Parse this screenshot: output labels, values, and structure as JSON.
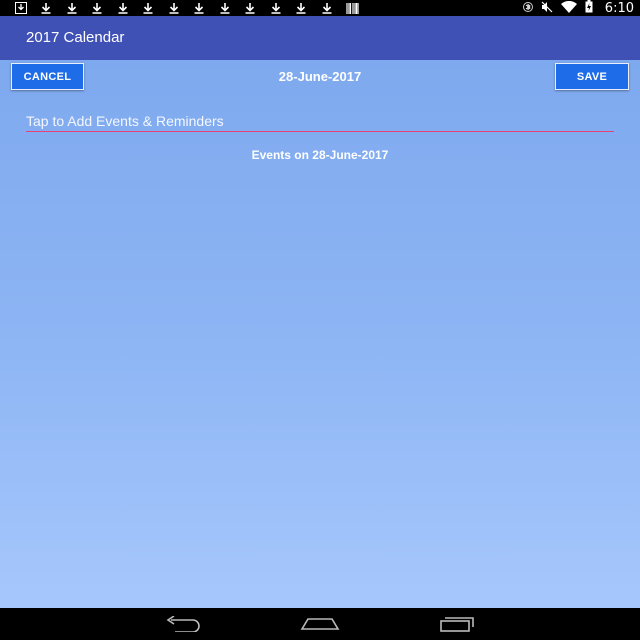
{
  "status_bar": {
    "notification_icons": [
      "download-icon",
      "download-icon",
      "download-icon",
      "download-icon",
      "download-icon",
      "download-icon",
      "download-icon",
      "download-icon",
      "download-icon",
      "download-icon",
      "download-icon",
      "download-icon",
      "download-icon"
    ],
    "time": "6:10"
  },
  "app_bar": {
    "title": "2017 Calendar"
  },
  "toolbar": {
    "cancel_label": "CANCEL",
    "save_label": "SAVE",
    "date": "28-June-2017"
  },
  "event_input": {
    "placeholder": "Tap to Add Events & Reminders",
    "value": ""
  },
  "events": {
    "label": "Events on 28-June-2017"
  },
  "colors": {
    "app_bar": "#3f51b5",
    "button": "#1e6ce8",
    "input_underline": "#e8417a",
    "content_background": "#8db5f4"
  }
}
